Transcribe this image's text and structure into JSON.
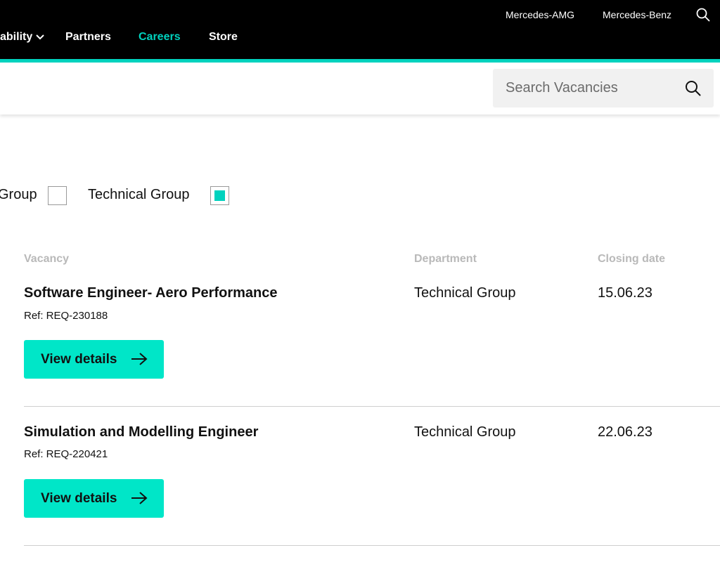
{
  "utility_nav": {
    "links": [
      {
        "label": "Mercedes-AMG"
      },
      {
        "label": "Mercedes-Benz"
      }
    ],
    "search_icon": "search-icon"
  },
  "main_nav": {
    "items": [
      {
        "label": "ability",
        "has_dropdown": true
      },
      {
        "label": "Partners"
      },
      {
        "label": "Careers",
        "active": true
      },
      {
        "label": "Store"
      }
    ]
  },
  "colors": {
    "accent": "#00d2be",
    "button": "#00e6c8",
    "nav_bg": "#000000"
  },
  "vacancy_search": {
    "placeholder": "Search Vacancies",
    "value": ""
  },
  "filters": [
    {
      "label": "Group",
      "checked": false
    },
    {
      "label": "Technical Group",
      "checked": true
    }
  ],
  "table": {
    "headers": {
      "vacancy": "Vacancy",
      "department": "Department",
      "closing_date": "Closing date"
    },
    "rows": [
      {
        "title": "Software Engineer- Aero Performance",
        "ref": "Ref: REQ-230188",
        "department": "Technical Group",
        "closing_date": "15.06.23",
        "button_label": "View details"
      },
      {
        "title": "Simulation and Modelling Engineer",
        "ref": "Ref: REQ-220421",
        "department": "Technical Group",
        "closing_date": "22.06.23",
        "button_label": "View details"
      }
    ]
  }
}
